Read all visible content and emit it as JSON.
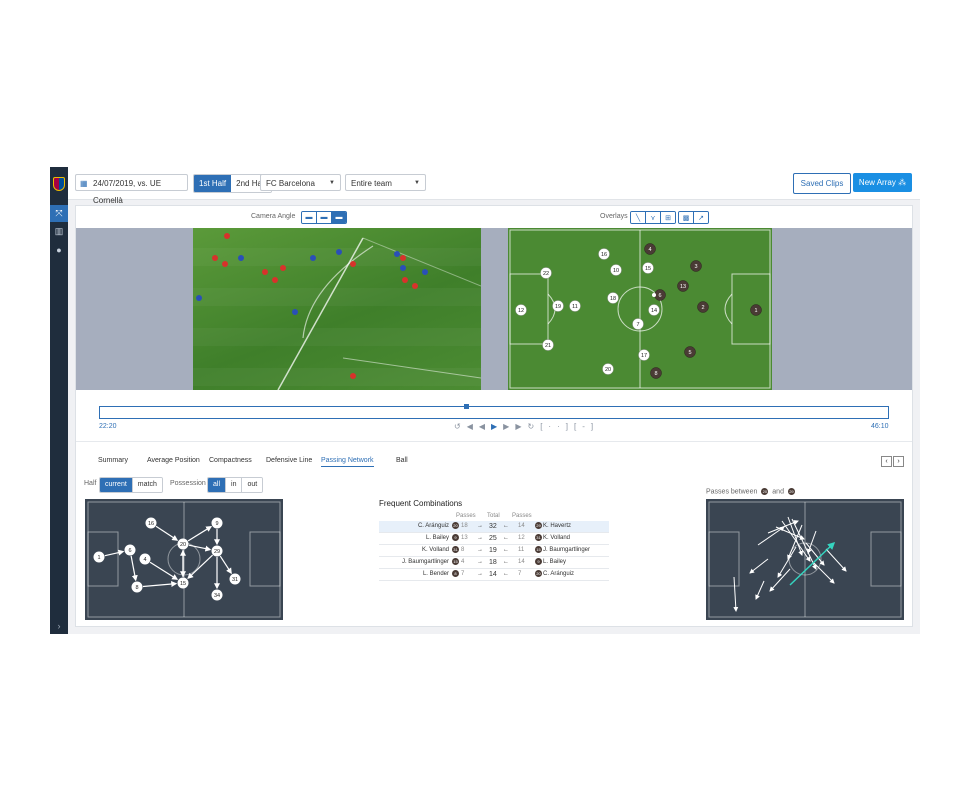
{
  "top": {
    "match": "24/07/2019, vs. UE Cornellà",
    "half_1": "1st Half",
    "half_2": "2nd Half",
    "team": "FC Barcelona",
    "scope": "Entire team",
    "saved_clips": "Saved Clips",
    "new_array": "New Array"
  },
  "view": {
    "camera_label": "Camera Angle",
    "overlays_label": "Overlays"
  },
  "timeline": {
    "start": "22:20",
    "end": "46:10",
    "progress": 0.465
  },
  "tabs": [
    "Summary",
    "Average Position",
    "Compactness",
    "Defensive Line",
    "Passing Network",
    "Ball"
  ],
  "active_tab": "Passing Network",
  "filters": {
    "half_label": "Half",
    "half_options": [
      "current",
      "match"
    ],
    "possession_label": "Possession",
    "possession_options": [
      "all",
      "in",
      "out"
    ]
  },
  "mini_pitch": {
    "home": [
      "16",
      "22",
      "10",
      "18",
      "15",
      "12",
      "21",
      "20",
      "17",
      "7",
      "14",
      "19",
      "11"
    ],
    "away": [
      "4",
      "3",
      "13",
      "2",
      "1",
      "6",
      "5",
      "8"
    ]
  },
  "network_players": [
    "1",
    "6",
    "4",
    "8",
    "16",
    "20",
    "15",
    "9",
    "29",
    "31",
    "34"
  ],
  "combinations": {
    "title": "Frequent Combinations",
    "head": {
      "passes_left": "Passes",
      "total": "Total",
      "passes_right": "Passes"
    },
    "rows": [
      {
        "p1": "C. Aránguiz",
        "b1": "20",
        "l": "18",
        "t": "32",
        "r": "14",
        "b2": "29",
        "p2": "K. Havertz"
      },
      {
        "p1": "L. Bailey",
        "b1": "9",
        "l": "13",
        "t": "25",
        "r": "12",
        "b2": "31",
        "p2": "K. Volland"
      },
      {
        "p1": "K. Volland",
        "b1": "31",
        "l": "8",
        "t": "19",
        "r": "11",
        "b2": "15",
        "p2": "J. Baumgartlinger"
      },
      {
        "p1": "J. Baumgartlinger",
        "b1": "15",
        "l": "4",
        "t": "18",
        "r": "14",
        "b2": "9",
        "p2": "L. Bailey"
      },
      {
        "p1": "L. Bender",
        "b1": "8",
        "l": "7",
        "t": "14",
        "r": "7",
        "b2": "20",
        "p2": "C. Aránguiz"
      }
    ]
  },
  "passes_between": {
    "prefix": "Passes between",
    "and": "and",
    "b1": "20",
    "b2": "29"
  }
}
